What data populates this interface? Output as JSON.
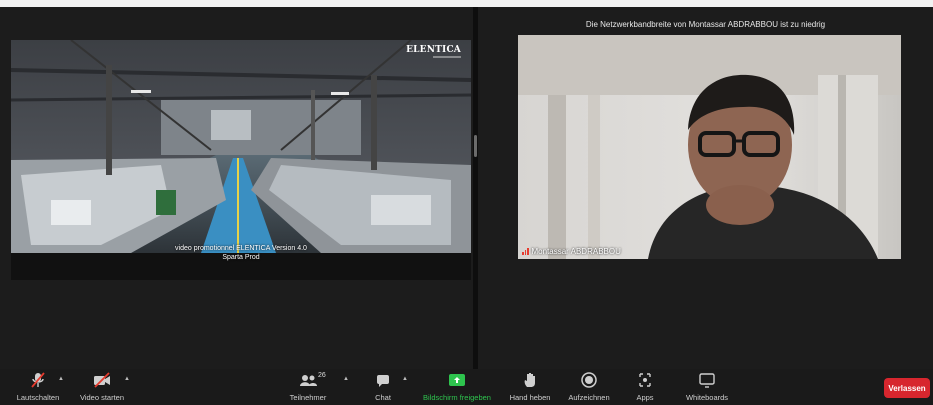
{
  "left_video": {
    "brand": "ELENTICA",
    "caption_line1": "video promotionnel ELENTICA Version 4.0",
    "caption_line2": "Sparta Prod"
  },
  "right_video": {
    "bandwidth_warning": "Die Netzwerkbandbreite von Montassar ABDRABBOU ist zu niedrig",
    "participant_name": "Montassar ABDRABBOU"
  },
  "toolbar": {
    "mute_label": "Lautschalten",
    "video_label": "Video starten",
    "participants_label": "Teilnehmer",
    "participants_count": "26",
    "chat_label": "Chat",
    "share_label": "Bildschirm freigeben",
    "hand_label": "Hand heben",
    "record_label": "Aufzeichnen",
    "apps_label": "Apps",
    "whiteboards_label": "Whiteboards",
    "leave_label": "Verlassen"
  },
  "colors": {
    "share_green": "#2ec44e",
    "leave_red": "#d7262e",
    "muted_red": "#e63b2e"
  }
}
